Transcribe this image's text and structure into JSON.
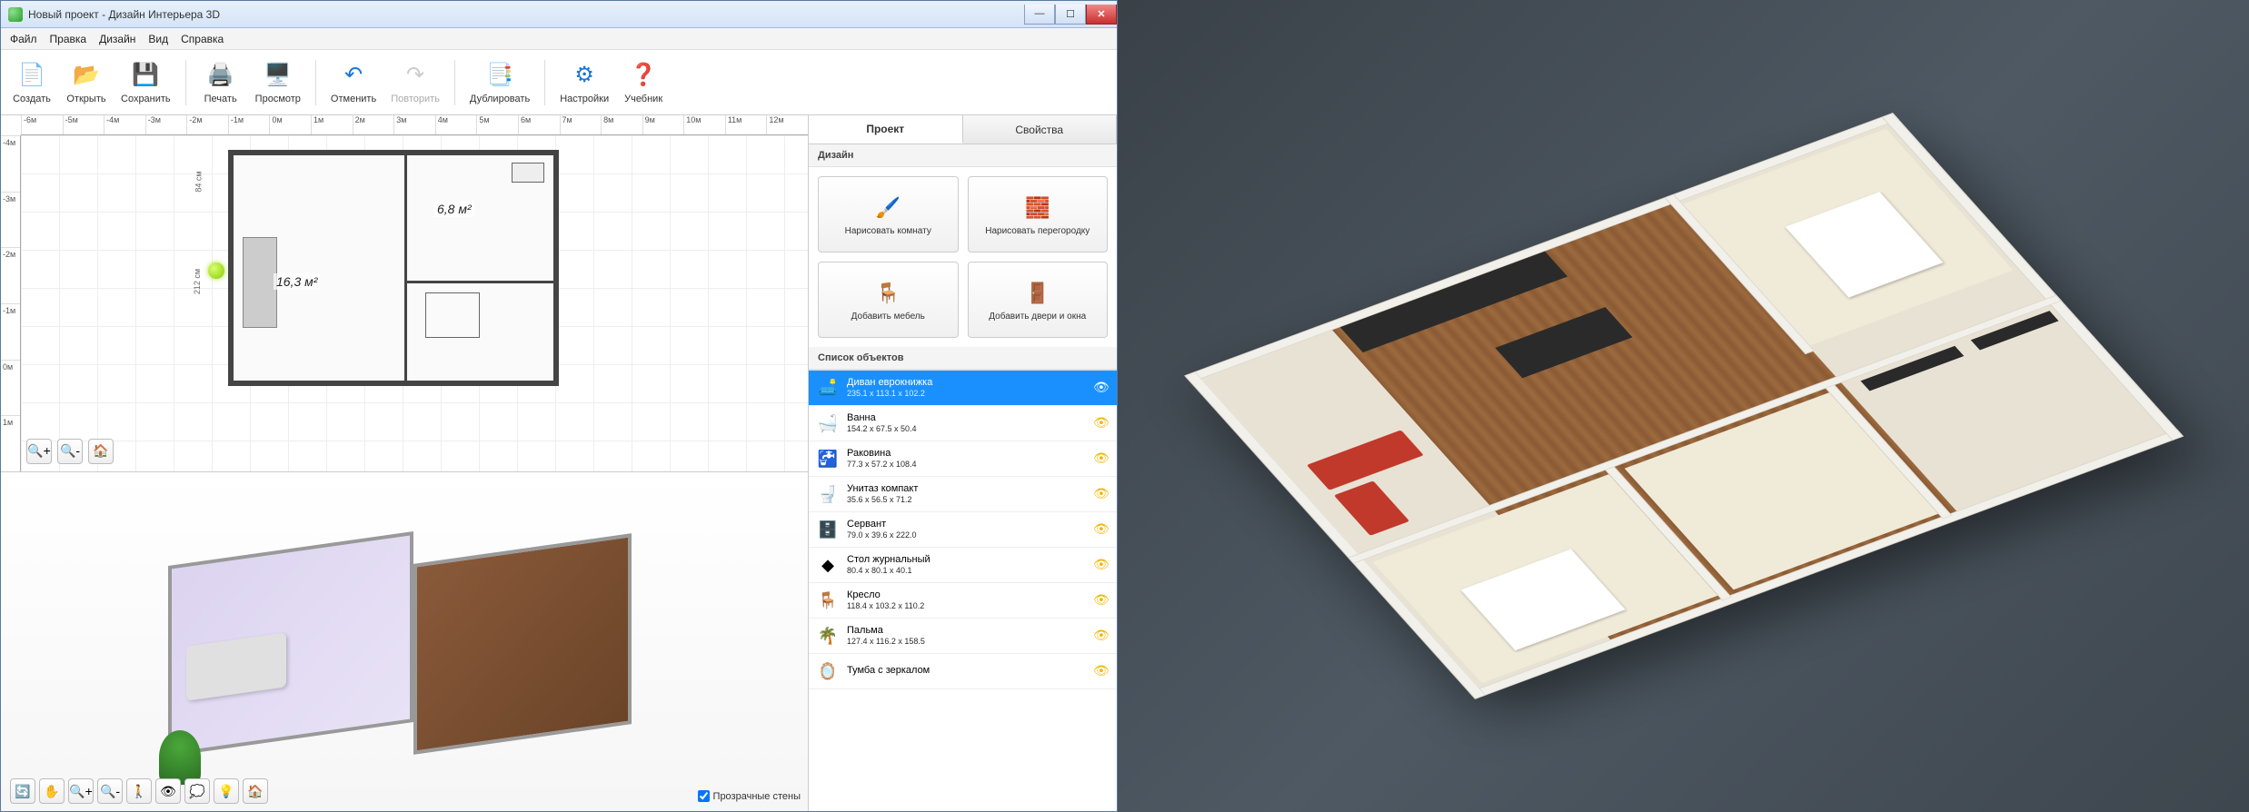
{
  "window": {
    "title": "Новый проект - Дизайн Интерьера 3D"
  },
  "menu": {
    "items": [
      "Файл",
      "Правка",
      "Дизайн",
      "Вид",
      "Справка"
    ]
  },
  "toolbar": {
    "create": "Создать",
    "open": "Открыть",
    "save": "Сохранить",
    "print": "Печать",
    "view": "Просмотр",
    "undo": "Отменить",
    "redo": "Повторить",
    "duplicate": "Дублировать",
    "settings": "Настройки",
    "tutorial": "Учебник"
  },
  "ruler": {
    "h": [
      "-6м",
      "-5м",
      "-4м",
      "-3м",
      "-2м",
      "-1м",
      "0м",
      "1м",
      "2м",
      "3м",
      "4м",
      "5м",
      "6м",
      "7м",
      "8м",
      "9м",
      "10м",
      "11м",
      "12м"
    ],
    "v": [
      "-4м",
      "-3м",
      "-2м",
      "-1м",
      "0м",
      "1м"
    ]
  },
  "plan": {
    "room1_label": "16,3 м²",
    "room2_label": "6,8 м²",
    "dim_h": "84 см",
    "dim_v": "212 см"
  },
  "side": {
    "tabs": {
      "project": "Проект",
      "properties": "Свойства"
    },
    "design_header": "Дизайн",
    "design_buttons": {
      "draw_room": "Нарисовать комнату",
      "draw_partition": "Нарисовать перегородку",
      "add_furniture": "Добавить мебель",
      "add_doors": "Добавить двери и окна"
    },
    "objects_header": "Список объектов",
    "objects": [
      {
        "name": "Диван еврокнижка",
        "dims": "235.1 x 113.1 x 102.2",
        "icon": "🛋️",
        "selected": true
      },
      {
        "name": "Ванна",
        "dims": "154.2 x 67.5 x 50.4",
        "icon": "🛁",
        "selected": false
      },
      {
        "name": "Раковина",
        "dims": "77.3 x 57.2 x 108.4",
        "icon": "🚰",
        "selected": false
      },
      {
        "name": "Унитаз компакт",
        "dims": "35.6 x 56.5 x 71.2",
        "icon": "🚽",
        "selected": false
      },
      {
        "name": "Сервант",
        "dims": "79.0 x 39.6 x 222.0",
        "icon": "🗄️",
        "selected": false
      },
      {
        "name": "Стол журнальный",
        "dims": "80.4 x 80.1 x 40.1",
        "icon": "◆",
        "selected": false
      },
      {
        "name": "Кресло",
        "dims": "118.4 x 103.2 x 110.2",
        "icon": "🪑",
        "selected": false
      },
      {
        "name": "Пальма",
        "dims": "127.4 x 116.2 x 158.5",
        "icon": "🌴",
        "selected": false
      },
      {
        "name": "Тумба с зеркалом",
        "dims": "",
        "icon": "🪞",
        "selected": false
      }
    ]
  },
  "preview": {
    "transparent_walls": "Прозрачные стены"
  }
}
